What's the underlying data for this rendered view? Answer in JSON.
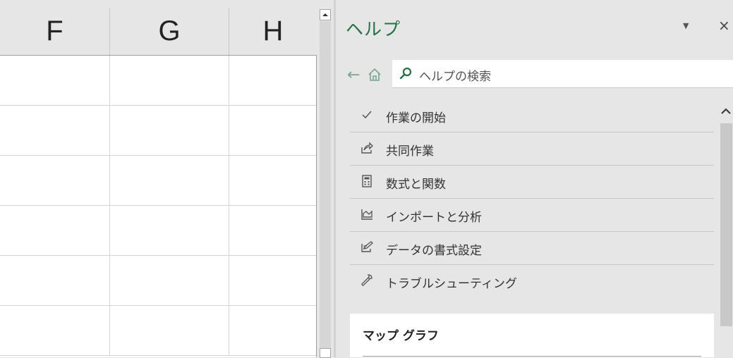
{
  "sheet": {
    "columns": [
      "F",
      "G",
      "H"
    ]
  },
  "help_pane": {
    "title": "ヘルプ",
    "menu_glyph": "▼",
    "close_glyph": "×",
    "back_glyph": "←",
    "search": {
      "placeholder": "ヘルプの検索"
    },
    "items": [
      {
        "label": "作業の開始",
        "icon": "checkmark-icon"
      },
      {
        "label": "共同作業",
        "icon": "share-icon"
      },
      {
        "label": "数式と関数",
        "icon": "calculator-icon"
      },
      {
        "label": "インポートと分析",
        "icon": "chart-icon"
      },
      {
        "label": "データの書式設定",
        "icon": "format-icon"
      },
      {
        "label": "トラブルシューティング",
        "icon": "wrench-icon"
      }
    ],
    "card": {
      "title": "マップ グラフ"
    }
  },
  "colors": {
    "accent": "#217346",
    "background": "#e6e6e6"
  }
}
